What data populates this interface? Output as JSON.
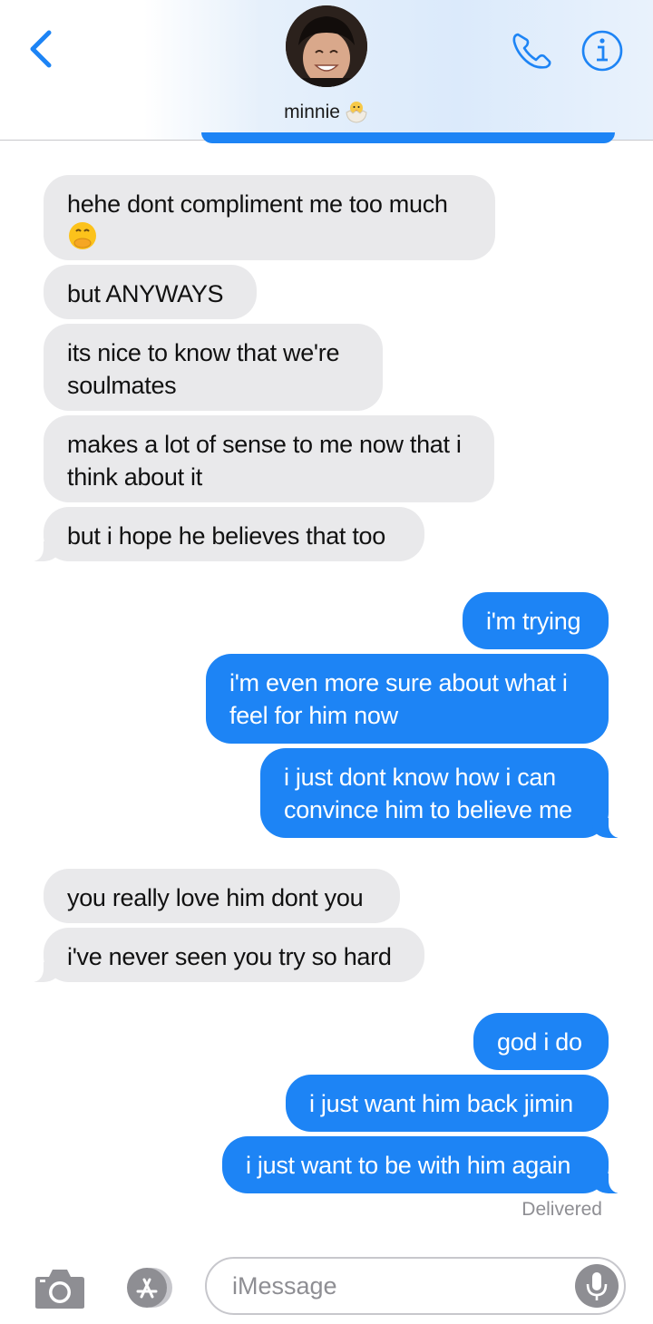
{
  "header": {
    "contact_name": "minnie",
    "avatar": "avatar-photo",
    "contact_emoji": "hatching-chick-icon",
    "back_icon": "chevron-left-icon",
    "call_icon": "phone-icon",
    "info_icon": "info-icon"
  },
  "messages": [
    {
      "dir": "in",
      "text": "hehe dont compliment me too much"
    },
    {
      "dir": "in",
      "text": "but ANYWAYS"
    },
    {
      "dir": "in",
      "text": "its nice to know that we're soulmates"
    },
    {
      "dir": "in",
      "text": "makes a lot of sense to me now that i think about it"
    },
    {
      "dir": "in",
      "text": "but i hope he believes that too"
    },
    {
      "dir": "out",
      "text": "i'm trying"
    },
    {
      "dir": "out",
      "text": "i'm even more sure about what i feel for him now"
    },
    {
      "dir": "out",
      "text": "i just dont know how i can convince him to believe me"
    },
    {
      "dir": "in",
      "text": "you really love him dont you"
    },
    {
      "dir": "in",
      "text": "i've never seen you try so hard"
    },
    {
      "dir": "out",
      "text": "god i do"
    },
    {
      "dir": "out",
      "text": "i just want him back jimin"
    },
    {
      "dir": "out",
      "text": "i just want to be with him again"
    }
  ],
  "status": {
    "delivered": "Delivered"
  },
  "composer": {
    "placeholder": "iMessage",
    "camera_icon": "camera-icon",
    "apps_icon": "app-store-icon",
    "mic_icon": "microphone-icon"
  },
  "colors": {
    "accent": "#1d84f5",
    "incoming_bubble": "#e9e9eb",
    "secondary_text": "#8e8e93"
  }
}
